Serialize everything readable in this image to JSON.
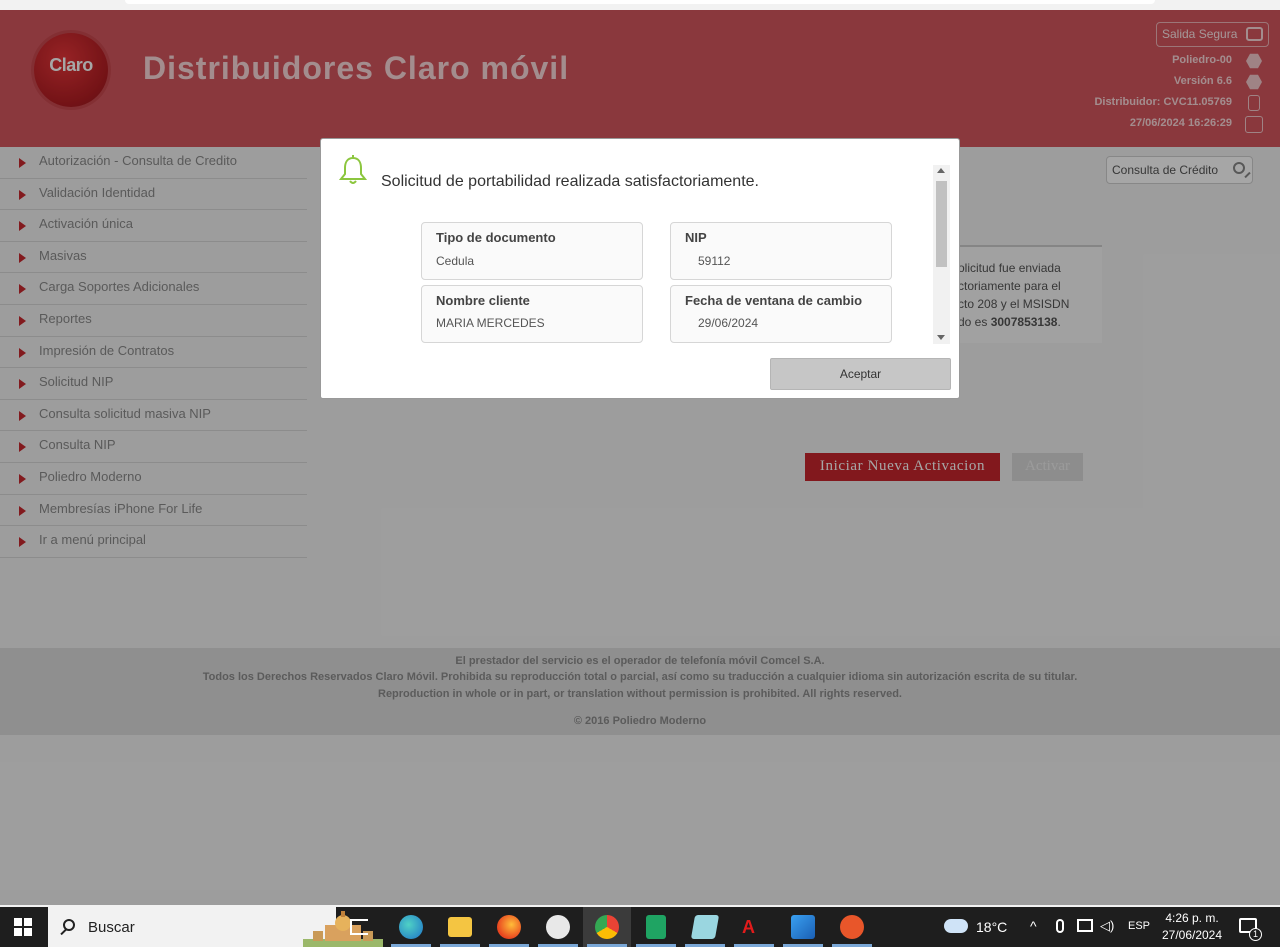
{
  "header": {
    "logo_text": "Claro",
    "title": "Distribuidores Claro móvil",
    "logout_label": "Salida Segura",
    "server": "Poliedro-00",
    "version": "Versión 6.6",
    "distributor": "Distribuidor: CVC11.05769",
    "datetime": "27/06/2024 16:26:29"
  },
  "sidebar": {
    "items": [
      {
        "label": "Autorización - Consulta de Credito"
      },
      {
        "label": "Validación Identidad"
      },
      {
        "label": "Activación única"
      },
      {
        "label": "Masivas"
      },
      {
        "label": "Carga Soportes Adicionales"
      },
      {
        "label": "Reportes"
      },
      {
        "label": "Impresión de Contratos"
      },
      {
        "label": "Solicitud NIP"
      },
      {
        "label": "Consulta solicitud masiva NIP"
      },
      {
        "label": "Consulta NIP"
      },
      {
        "label": "Poliedro Moderno"
      },
      {
        "label": "Membresías iPhone For Life"
      },
      {
        "label": "Ir a menú principal"
      }
    ]
  },
  "main": {
    "credit_search_label": "Consulta de Crédito",
    "message_lines": [
      "olicitud fue enviada",
      "ctoriamente para el",
      "cto 208 y el MSISDN",
      "do es "
    ],
    "message_msisdn": "3007853138",
    "message_end": ".",
    "new_activation_button": "Iniciar Nueva Activacion",
    "activate_button": "Activar"
  },
  "footer": {
    "line1": "El prestador del servicio es el operador de telefonía móvil Comcel S.A.",
    "line2": "Todos los Derechos Reservados Claro Móvil. Prohibida su reproducción total o parcial, así como su traducción a cualquier idioma sin autorización escrita de su titular.",
    "line3": "Reproduction in whole or in part, or translation without permission is prohibited. All rights reserved.",
    "copyright": "© 2016 Poliedro Moderno"
  },
  "modal": {
    "message": "Solicitud de portabilidad realizada satisfactoriamente.",
    "fields": {
      "doc_type_label": "Tipo de documento",
      "doc_type_value": "Cedula",
      "nip_label": "NIP",
      "nip_value": "59112",
      "client_label": "Nombre cliente",
      "client_value": "MARIA MERCEDES",
      "window_label": "Fecha de ventana de cambio",
      "window_value": "29/06/2024"
    },
    "accept_button": "Aceptar"
  },
  "taskbar": {
    "search_placeholder": "Buscar",
    "weather": "18°C",
    "language": "ESP",
    "time": "4:26 p. m.",
    "date": "27/06/2024",
    "notifications": "1"
  },
  "colors": {
    "brand_red": "#c8262d",
    "header_bg": "#d4575f"
  }
}
